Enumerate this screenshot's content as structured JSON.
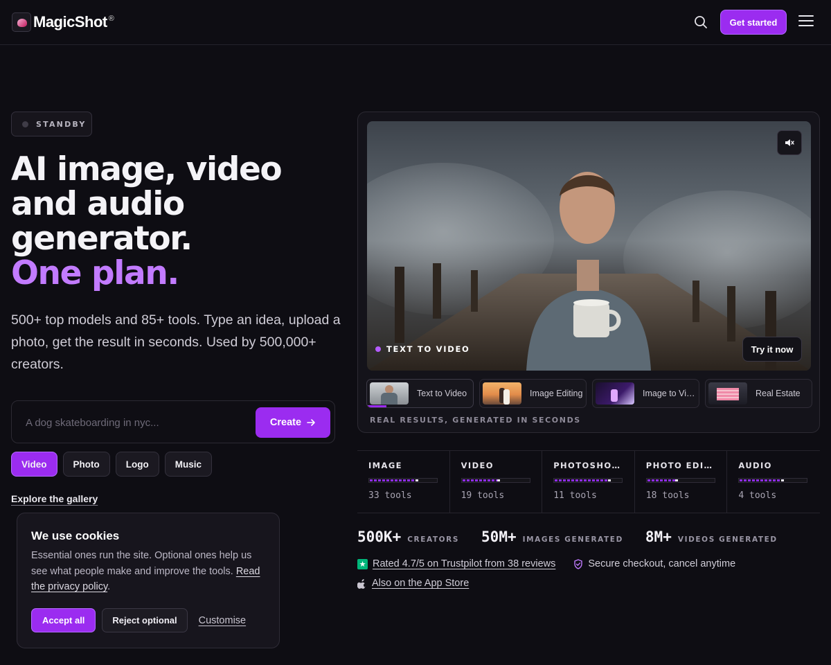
{
  "header": {
    "logo_text": "MagicShot",
    "logo_reg": "®",
    "get_started": "Get started",
    "search_icon": "search-icon",
    "menu_icon": "hamburger-menu-icon"
  },
  "hero": {
    "status_badge": "STANDBY",
    "headline_line1": "AI image, video",
    "headline_line2": "and audio",
    "headline_line3": "generator.",
    "headline_accent": "One plan.",
    "subcopy": "500+ top models and 85+ tools. Type an idea, upload a photo, get the result in seconds. Used by 500,000+ creators.",
    "prompt_placeholder": "A dog skateboarding in nyc...",
    "prompt_value": "",
    "create_label": "Create",
    "modes": [
      "Video",
      "Photo",
      "Logo",
      "Music"
    ],
    "active_mode": "Video",
    "explore_gallery": "Explore the gallery"
  },
  "cookie": {
    "title": "We use cookies",
    "body": "Essential ones run the site. Optional ones help us see what people make and improve the tools.",
    "policy_link": "Read the privacy policy",
    "body_end": ".",
    "accept": "Accept all",
    "reject": "Reject optional",
    "customise": "Customise"
  },
  "media": {
    "video_label": "TEXT TO VIDEO",
    "try_label": "Try it now",
    "mute_icon": "speaker-mute-icon",
    "thumbnails": [
      {
        "label": "Text to Video"
      },
      {
        "label": "Image Editing"
      },
      {
        "label": "Image to Video"
      },
      {
        "label": "Real Estate"
      }
    ],
    "active_thumbnail": 0,
    "caption": "REAL RESULTS, GENERATED IN SECONDS"
  },
  "categories": [
    {
      "name": "IMAGE",
      "count": "33 tools",
      "fill": 0.72
    },
    {
      "name": "VIDEO",
      "count": "19 tools",
      "fill": 0.56
    },
    {
      "name": "PHOTOSHOOT",
      "count": "11 tools",
      "fill": 0.84
    },
    {
      "name": "PHOTO EDITING",
      "count": "18 tools",
      "fill": 0.46
    },
    {
      "name": "AUDIO",
      "count": "4 tools",
      "fill": 0.66
    }
  ],
  "stats": [
    {
      "value": "500K+",
      "label": "CREATORS"
    },
    {
      "value": "50M+",
      "label": "IMAGES GENERATED"
    },
    {
      "value": "8M+",
      "label": "VIDEOS GENERATED"
    }
  ],
  "trust": {
    "trustpilot": "Rated 4.7/5 on Trustpilot from 38 reviews",
    "secure": "Secure checkout, cancel anytime",
    "app_store": "Also on the App Store"
  },
  "colors": {
    "accent": "#9b2cf0",
    "accent_text": "#c27bff",
    "background": "#0e0d13",
    "trustpilot_green": "#00b67a"
  }
}
